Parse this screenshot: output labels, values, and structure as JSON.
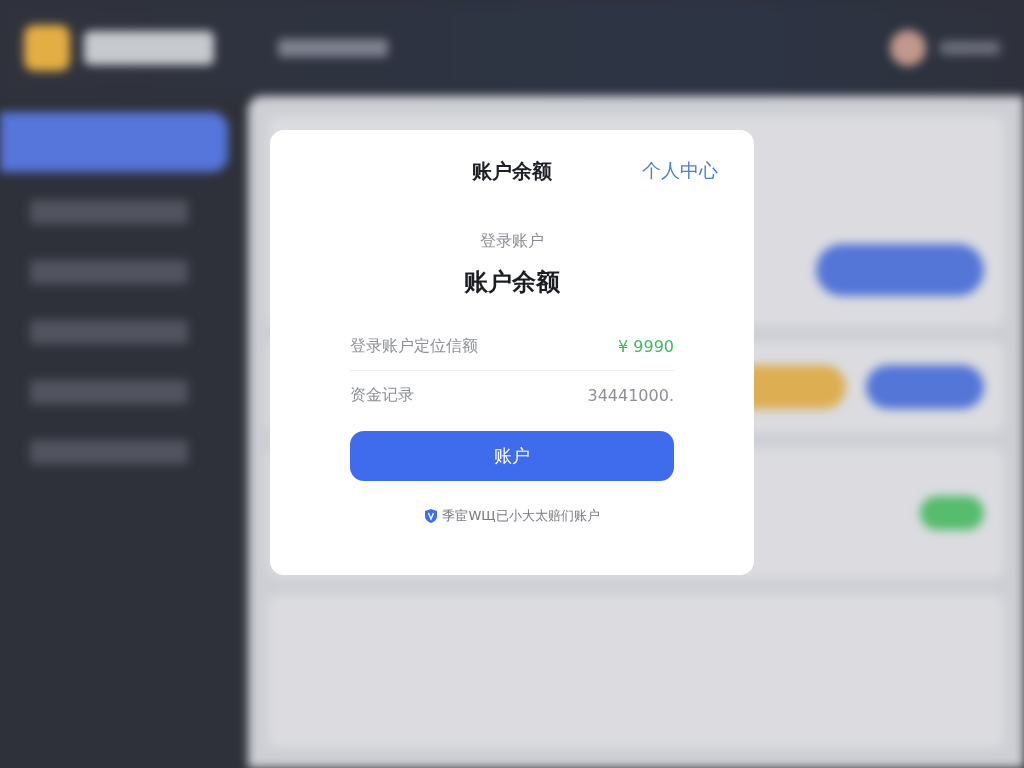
{
  "dialog": {
    "title": "账户余额",
    "header_link": "个人中心",
    "subtitle": "登录账户",
    "heading": "账户余额",
    "rows": [
      {
        "label": "登录账户定位信额",
        "value": "¥ 9990",
        "kind": "positive"
      },
      {
        "label": "资金记录",
        "value": "34441000.",
        "kind": "muted"
      }
    ],
    "button": "账户",
    "footer": "季宦WЩ已小大太赔们账户"
  }
}
